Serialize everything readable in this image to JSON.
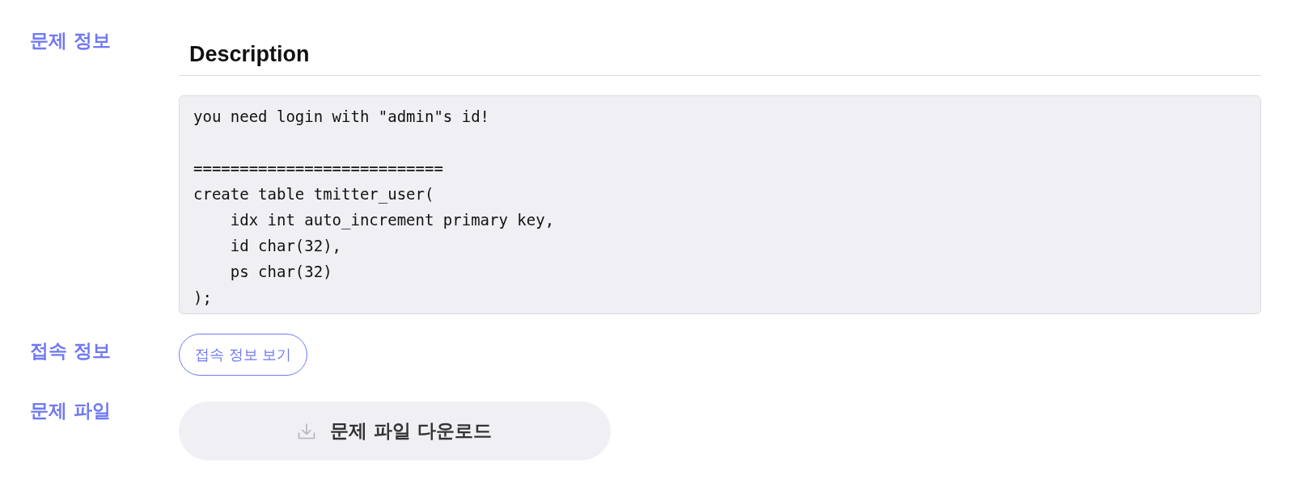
{
  "sections": [
    {
      "kind": "description",
      "label": "문제 정보",
      "heading": "Description",
      "code": "you need login with \"admin\"s id!\n\n===========================\ncreate table tmitter_user(\n    idx int auto_increment primary key,\n    id char(32),\n    ps char(32)\n);"
    },
    {
      "kind": "link_button",
      "label": "접속 정보",
      "button": "접속 정보 보기"
    },
    {
      "kind": "download_button",
      "label": "문제 파일",
      "button": "문제 파일 다운로드"
    }
  ]
}
